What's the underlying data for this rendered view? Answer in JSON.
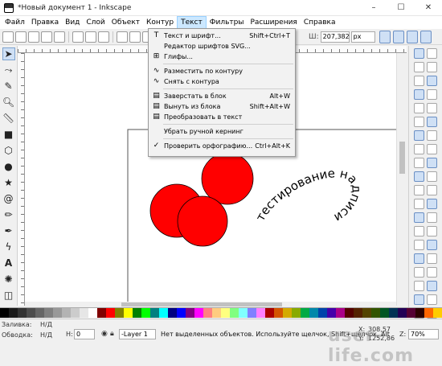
{
  "window": {
    "title": "*Новый документ 1 - Inkscape",
    "min": "–",
    "max": "☐",
    "close": "✕"
  },
  "menubar": [
    "Файл",
    "Правка",
    "Вид",
    "Слой",
    "Объект",
    "Контур",
    "Текст",
    "Фильтры",
    "Расширения",
    "Справка"
  ],
  "menubar_active": "Текст",
  "toolbar": {
    "x_label": "Ш:",
    "x_value": "207,382",
    "unit": "px"
  },
  "text_menu": [
    {
      "icon": "T",
      "label": "Текст и шрифт...",
      "shortcut": "Shift+Ctrl+T"
    },
    {
      "icon": "",
      "label": "Редактор шрифтов SVG...",
      "shortcut": ""
    },
    {
      "icon": "⊞",
      "label": "Глифы...",
      "shortcut": ""
    },
    {
      "sep": true
    },
    {
      "icon": "∿",
      "label": "Разместить по контуру",
      "shortcut": ""
    },
    {
      "icon": "∿",
      "label": "Снять с контура",
      "shortcut": ""
    },
    {
      "sep": true
    },
    {
      "icon": "▤",
      "label": "Заверстать в блок",
      "shortcut": "Alt+W"
    },
    {
      "icon": "▤",
      "label": "Вынуть из блока",
      "shortcut": "Shift+Alt+W"
    },
    {
      "icon": "▤",
      "label": "Преобразовать в текст",
      "shortcut": ""
    },
    {
      "sep": true
    },
    {
      "icon": "",
      "label": "Убрать ручной кернинг",
      "shortcut": ""
    },
    {
      "sep": true
    },
    {
      "icon": "✓",
      "label": "Проверить орфографию...",
      "shortcut": "Ctrl+Alt+K"
    }
  ],
  "canvas": {
    "path_text": "тестирование надписи",
    "circle_color": "#ff0000"
  },
  "statusbar": {
    "fill_label": "Заливка:",
    "fill_value": "Н/Д",
    "stroke_label": "Обводка:",
    "stroke_value": "Н/Д",
    "h_label": "Н:",
    "h_value": "0",
    "layer": "-Layer 1",
    "message": "Нет выделенных объектов. Используйте щелчок, Shift+щелчок, Alt",
    "x_label": "X:",
    "x_value": "308,57",
    "y_label": "Y:",
    "y_value": "1252,86",
    "z_label": "Z:",
    "zoom": "70%",
    "watermark": "user-life.com"
  },
  "palette": [
    "#000000",
    "#1a1a1a",
    "#333333",
    "#4d4d4d",
    "#666666",
    "#808080",
    "#999999",
    "#b3b3b3",
    "#cccccc",
    "#e6e6e6",
    "#ffffff",
    "#800000",
    "#ff0000",
    "#808000",
    "#ffff00",
    "#008000",
    "#00ff00",
    "#008080",
    "#00ffff",
    "#000080",
    "#0000ff",
    "#800080",
    "#ff00ff",
    "#ff8080",
    "#ffcc80",
    "#ffff80",
    "#80ff80",
    "#80ffff",
    "#8080ff",
    "#ff80ff",
    "#aa0000",
    "#d45500",
    "#d4aa00",
    "#88aa00",
    "#00aa44",
    "#0088aa",
    "#0044aa",
    "#4400aa",
    "#aa0088",
    "#550000",
    "#552200",
    "#554400",
    "#335500",
    "#005522",
    "#003355",
    "#220055",
    "#550033",
    "#2b0000",
    "#ff6600",
    "#ffcc00"
  ]
}
